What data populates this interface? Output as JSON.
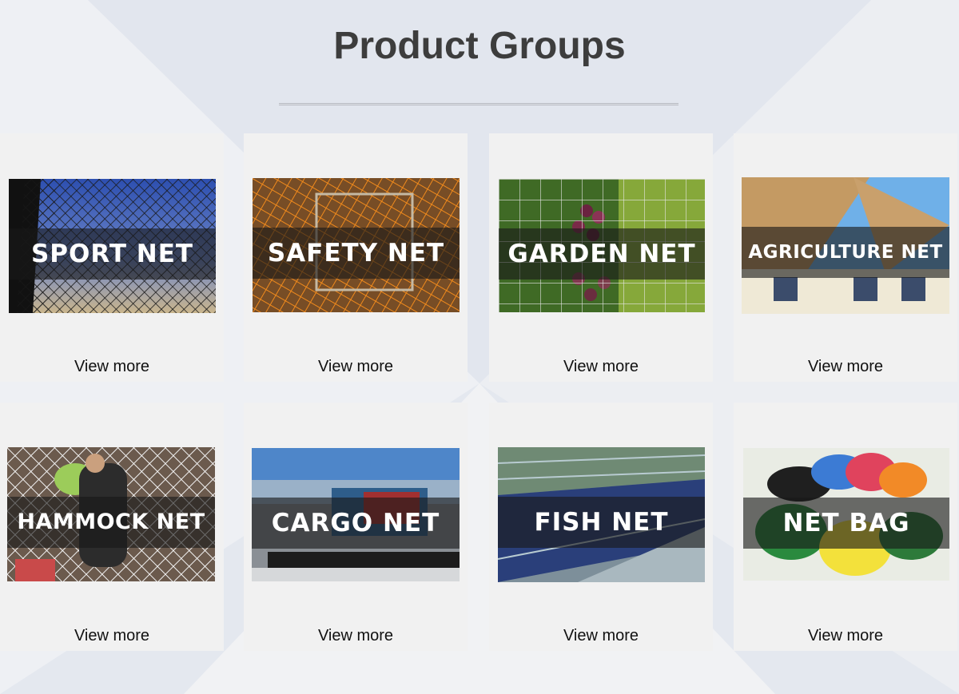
{
  "page": {
    "title": "Product Groups"
  },
  "products": [
    {
      "label": "SPORT NET",
      "link": "View more"
    },
    {
      "label": "SAFETY NET",
      "link": "View more"
    },
    {
      "label": "GARDEN NET",
      "link": "View more"
    },
    {
      "label": "AGRICULTURE NET",
      "link": "View more"
    },
    {
      "label": "HAMMOCK NET",
      "link": "View more"
    },
    {
      "label": "CARGO NET",
      "link": "View more"
    },
    {
      "label": "FISH NET",
      "link": "View more"
    },
    {
      "label": "NET BAG",
      "link": "View more"
    }
  ]
}
